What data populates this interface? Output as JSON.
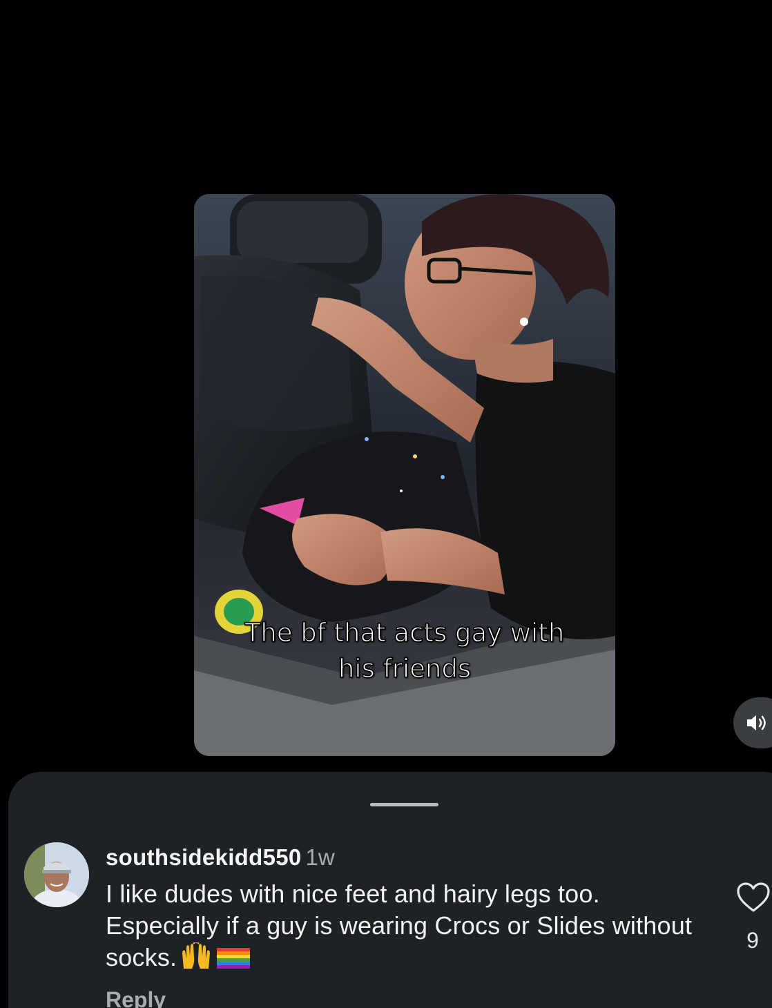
{
  "video": {
    "caption": "The bf that acts gay with his friends"
  },
  "sound": {
    "icon": "speaker-on-icon"
  },
  "comment": {
    "username": "southsidekidd550",
    "time": "1w",
    "text": "I like dudes with nice feet and hairy legs too. Especially if a guy is wearing Crocs or Slides without socks.",
    "emojis": [
      "raising-hands-emoji",
      "rainbow-flag-emoji"
    ],
    "like_count": "9",
    "reply_label": "Reply"
  },
  "colors": {
    "background": "#000000",
    "sheet": "#1e2226",
    "secondary_text": "#a8acb1"
  }
}
